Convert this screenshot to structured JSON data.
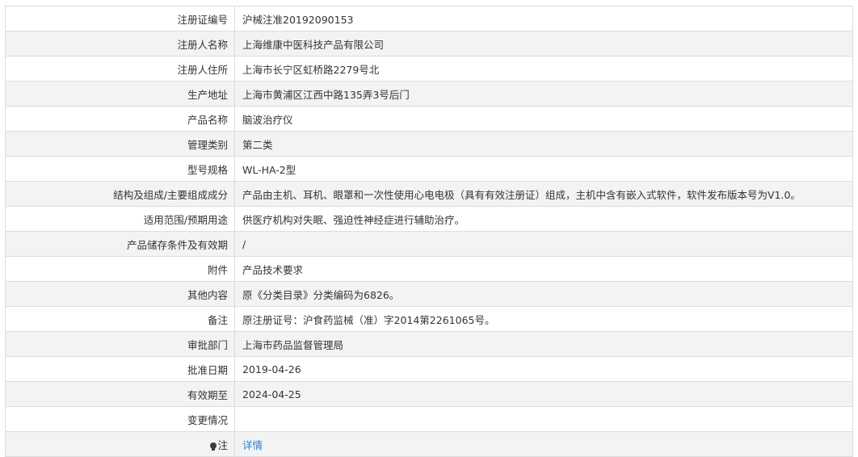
{
  "rows": [
    {
      "label": "注册证编号",
      "value": "沪械注准20192090153"
    },
    {
      "label": "注册人名称",
      "value": "上海维康中医科技产品有限公司"
    },
    {
      "label": "注册人住所",
      "value": "上海市长宁区虹桥路2279号北"
    },
    {
      "label": "生产地址",
      "value": "上海市黄浦区江西中路135弄3号后门"
    },
    {
      "label": "产品名称",
      "value": "脑波治疗仪"
    },
    {
      "label": "管理类别",
      "value": "第二类"
    },
    {
      "label": "型号规格",
      "value": "WL-HA-2型"
    },
    {
      "label": "结构及组成/主要组成成分",
      "value": "产品由主机、耳机、眼罩和一次性使用心电电极（具有有效注册证）组成，主机中含有嵌入式软件，软件发布版本号为V1.0。"
    },
    {
      "label": "适用范围/预期用途",
      "value": "供医疗机构对失眠、强迫性神经症进行辅助治疗。"
    },
    {
      "label": "产品储存条件及有效期",
      "value": "/"
    },
    {
      "label": "附件",
      "value": "产品技术要求"
    },
    {
      "label": "其他内容",
      "value": "原《分类目录》分类编码为6826。"
    },
    {
      "label": "备注",
      "value": "原注册证号：沪食药监械（准）字2014第2261065号。"
    },
    {
      "label": "审批部门",
      "value": "上海市药品监督管理局"
    },
    {
      "label": "批准日期",
      "value": "2019-04-26"
    },
    {
      "label": "有效期至",
      "value": "2024-04-25"
    },
    {
      "label": "变更情况",
      "value": ""
    }
  ],
  "note_row": {
    "label": "注",
    "link_text": "详情",
    "icon": "bulb-icon"
  },
  "colors": {
    "border": "#dcdcdc",
    "stripe": "#f3f3f3",
    "text": "#333333",
    "link": "#2f7fc6"
  }
}
